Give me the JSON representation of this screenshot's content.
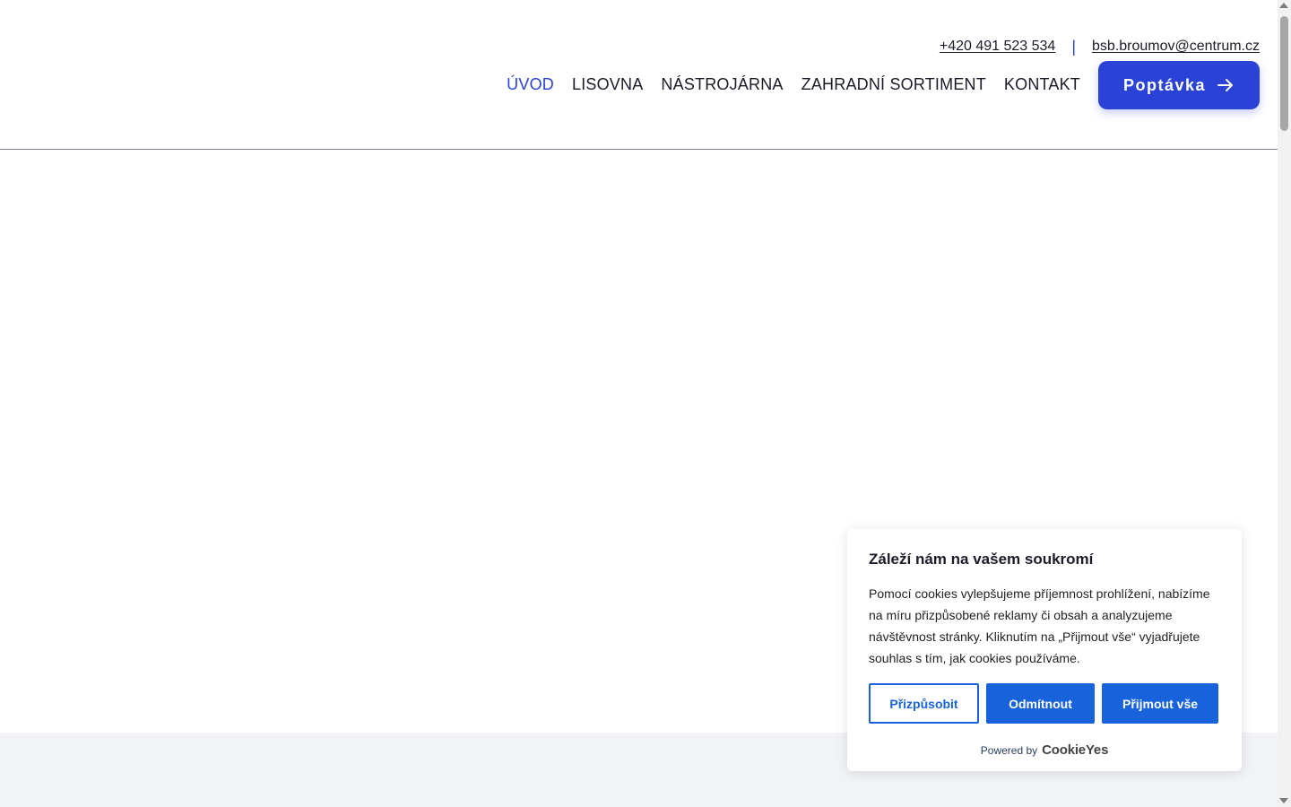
{
  "header": {
    "phone": "+420 491 523 534",
    "separator": "|",
    "email": "bsb.broumov@centrum.cz",
    "nav": [
      {
        "label": "ÚVOD",
        "active": true
      },
      {
        "label": "LISOVNA",
        "active": false
      },
      {
        "label": "NÁSTROJÁRNA",
        "active": false
      },
      {
        "label": "ZAHRADNÍ SORTIMENT",
        "active": false
      },
      {
        "label": "KONTAKT",
        "active": false
      }
    ],
    "cta_label": "Poptávka",
    "cta_icon": "arrow-right-icon"
  },
  "cookie": {
    "title": "Záleží nám na vašem soukromí",
    "text": "Pomocí cookies vylepšujeme příjemnost prohlížení, nabízíme na míru přizpůsobené reklamy či obsah a analyzujeme návštěvnost stránky. Kliknutím na „Přijmout vše“ vyjadřujete souhlas s tím, jak cookies používáme.",
    "customize_label": "Přizpůsobit",
    "reject_label": "Odmítnout",
    "accept_label": "Přijmout vše",
    "powered_by": "Powered by",
    "brand": "CookieYes"
  },
  "colors": {
    "accent": "#2a43d6",
    "cookie_button": "#1863dc",
    "band": "#f1f3f7"
  }
}
